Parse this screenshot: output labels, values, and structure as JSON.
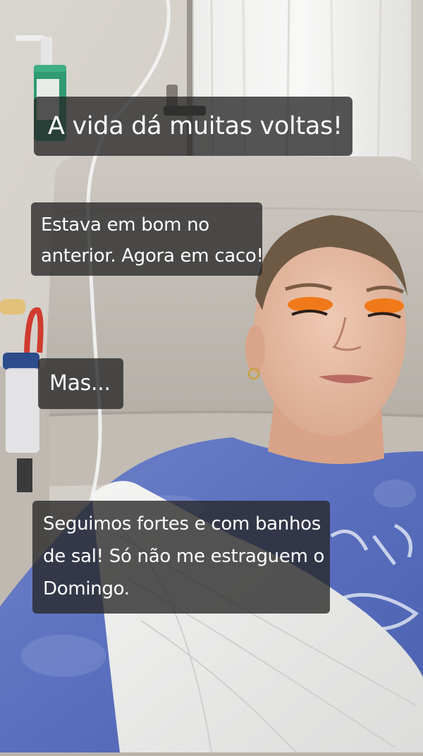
{
  "story": {
    "captions": [
      {
        "lines": [
          "A vida dá muitas voltas!"
        ]
      },
      {
        "lines": [
          "Estava em bom no",
          "anterior. Agora em caco!"
        ]
      },
      {
        "lines": [
          "Mas..."
        ]
      },
      {
        "lines": [
          "Seguimos fortes e com banhos",
          "de sal!  Só não me estraguem o",
          "Domingo."
        ]
      }
    ]
  },
  "colors": {
    "caption_background": "#262626",
    "caption_text": "#ffffff",
    "eyeshadow": "#f07a1a",
    "sweatshirt": "#5a72c4"
  }
}
